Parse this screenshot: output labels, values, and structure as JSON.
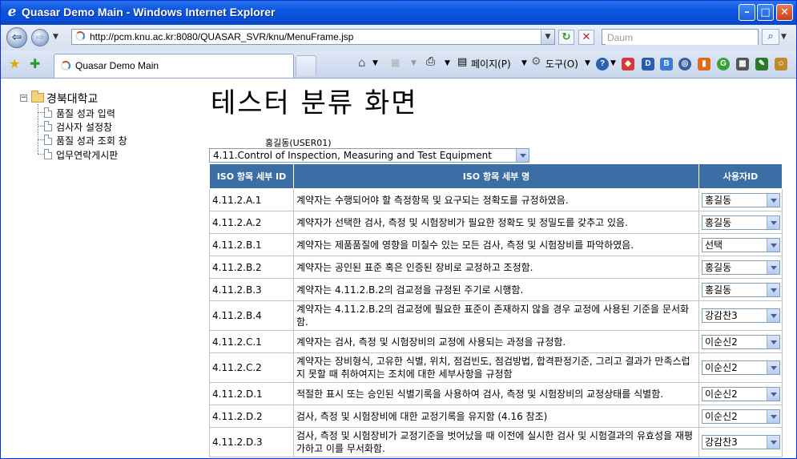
{
  "window": {
    "title": "Quasar Demo Main - Windows Internet Explorer"
  },
  "address": {
    "url": "http://pcm.knu.ac.kr:8080/QUASAR_SVR/knu/MenuFrame.jsp",
    "search_placeholder": "Daum"
  },
  "tabs": {
    "active_label": "Quasar Demo Main"
  },
  "toolbar": {
    "page_menu": "페이지(P)",
    "tools_menu": "도구(O)"
  },
  "tree": {
    "root": "경북대학교",
    "items": [
      "품질 성과 입력",
      "검사자 설정창",
      "품질 성과 조회 창",
      "업무연락게시판"
    ]
  },
  "main": {
    "heading": "테스터 분류 화면",
    "user": "홍길동(USER01)",
    "category": "4.11.Control of Inspection, Measuring and Test Equipment",
    "columns": [
      "ISO 항목 세부 ID",
      "ISO 항목 세부 명",
      "사용자ID"
    ],
    "rows": [
      {
        "id": "4.11.2.A.1",
        "name": "계약자는 수행되어야 할 측정항목 및 요구되는 정확도를 규정하였음.",
        "user": "홍길동"
      },
      {
        "id": "4.11.2.A.2",
        "name": "계약자가 선택한 검사, 측정 및 시험장비가 필요한 정확도 및 정밀도를 갖추고 있음.",
        "user": "홍길동"
      },
      {
        "id": "4.11.2.B.1",
        "name": "계약자는 제품품질에 영향을 미칠수 있는 모든 검사, 측정 및 시험장비를 파악하였음.",
        "user": "선택"
      },
      {
        "id": "4.11.2.B.2",
        "name": "계약자는 공인된 표준 혹은 인증된 장비로 교정하고 조정함.",
        "user": "홍길동"
      },
      {
        "id": "4.11.2.B.3",
        "name": "계약자는 4.11.2.B.2의 검교정을 규정된 주기로 시행함.",
        "user": "홍길동"
      },
      {
        "id": "4.11.2.B.4",
        "name": "계약자는 4.11.2.B.2의 검교정에 필요한 표준이 존재하지 않을 경우 교정에 사용된 기준을 문서화함.",
        "user": "강감찬3"
      },
      {
        "id": "4.11.2.C.1",
        "name": "계약자는 검사, 측정 및 시험장비의 교정에 사용되는 과정을 규정함.",
        "user": "이순신2"
      },
      {
        "id": "4.11.2.C.2",
        "name": "계약자는 장비형식, 고유한 식별, 위치, 점검빈도, 점검방법, 합격판정기준, 그리고 결과가 만족스럽지 못할 때 취하여지는 조치에 대한 세부사항을 규정함",
        "user": "이순신2"
      },
      {
        "id": "4.11.2.D.1",
        "name": "적절한 표시 또는 승인된 식별기록을 사용하여 검사, 측정 및 시험장비의 교정상태를 식별함.",
        "user": "이순신2"
      },
      {
        "id": "4.11.2.D.2",
        "name": "검사, 측정 및 시험장비에 대한 교정기록을 유지함 (4.16 참조)",
        "user": "이순신2"
      },
      {
        "id": "4.11.2.D.3",
        "name": "검사, 측정 및 시험장비가 교정기준을 벗어났을 때 이전에 실시한 검사 및 시험결과의 유효성을 재평가하고 이를 무서화함.",
        "user": "강감찬3"
      }
    ]
  }
}
